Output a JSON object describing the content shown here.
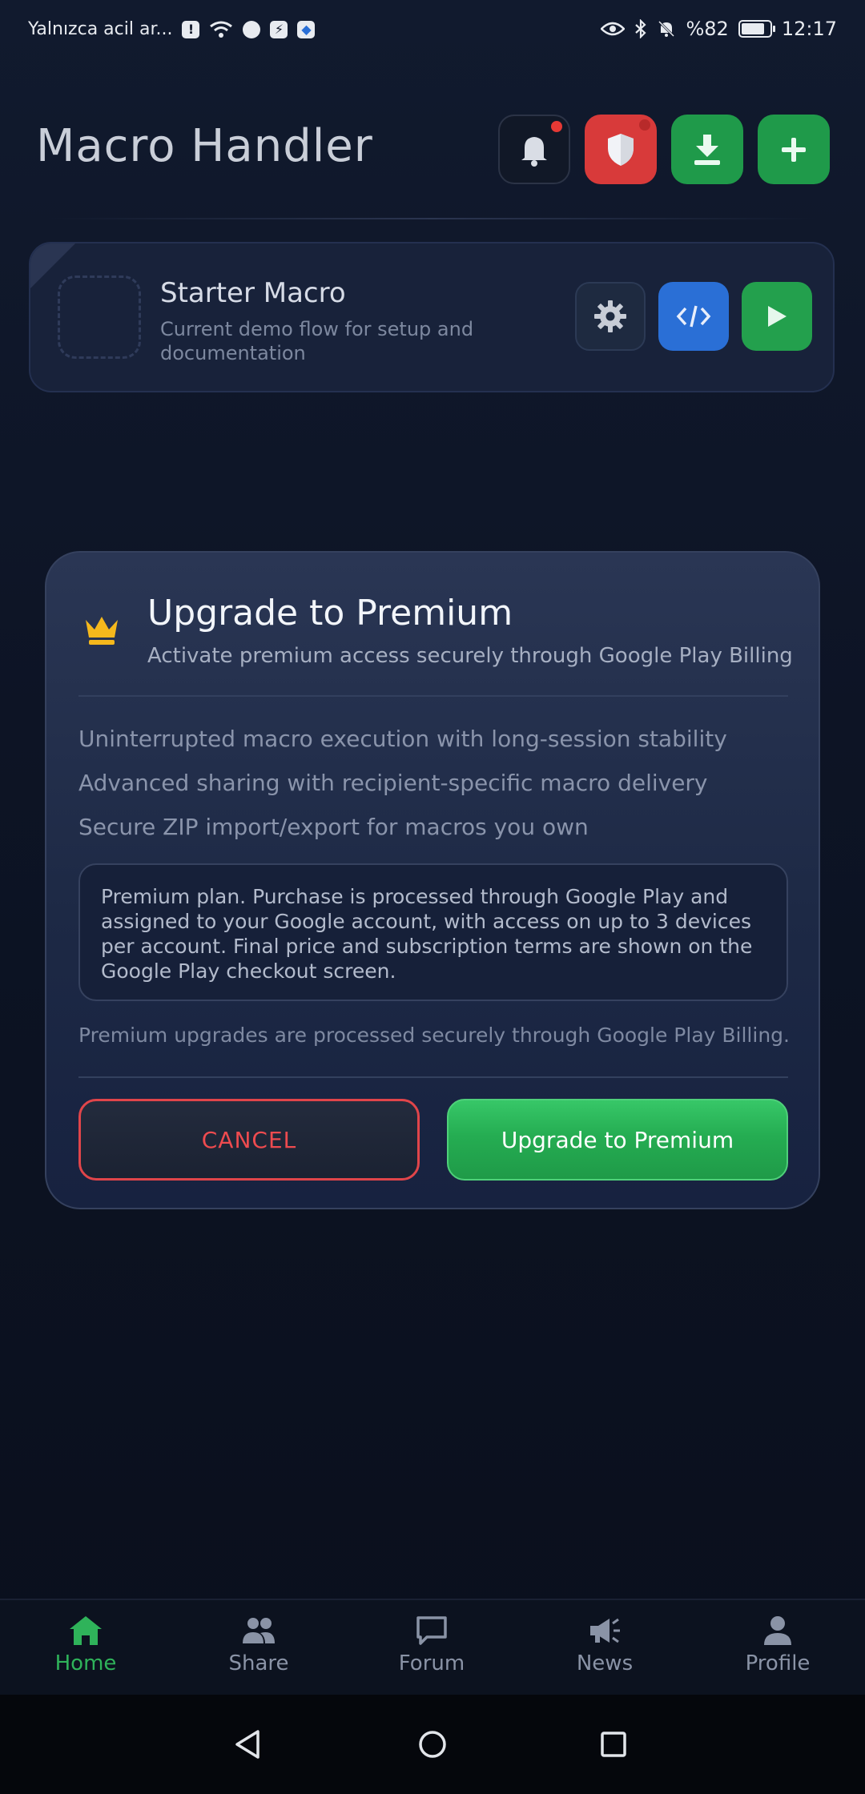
{
  "status_bar": {
    "left_text": "Yalnızca acil ar...",
    "battery_text": "%82",
    "battery_level": 0.82,
    "time": "12:17"
  },
  "header": {
    "title": "Macro Handler",
    "buttons": [
      {
        "name": "notifications",
        "icon": "bell-icon",
        "color": "#111827",
        "badge": true
      },
      {
        "name": "security",
        "icon": "shield-icon",
        "color": "#d83a3a",
        "badge": true
      },
      {
        "name": "download",
        "icon": "download-icon",
        "color": "#1f9a4a"
      },
      {
        "name": "add",
        "icon": "plus-icon",
        "color": "#1f9a4a"
      }
    ]
  },
  "macro_card": {
    "name": "Starter Macro",
    "description": "Current demo flow for setup and documentation"
  },
  "modal": {
    "title": "Upgrade to Premium",
    "subtitle": "Activate premium access securely through Google Play Billing",
    "features": [
      "Uninterrupted macro execution with long-session stability",
      "Advanced sharing with recipient-specific macro delivery",
      "Secure ZIP import/export for macros you own"
    ],
    "info": "Premium plan. Purchase is processed through Google Play and assigned to your Google account, with access on up to 3 devices per account. Final price and subscription terms are shown on the Google Play checkout screen.",
    "footnote": "Premium upgrades are processed securely through Google Play Billing.",
    "cancel_label": "CANCEL",
    "upgrade_label": "Upgrade to Premium",
    "accent_colors": {
      "cancel": "#ee4b4f",
      "upgrade": "#25ad52",
      "crown": "#f5b81c"
    }
  },
  "bottom_nav": {
    "items": [
      {
        "label": "Home",
        "icon": "home-icon",
        "active": true
      },
      {
        "label": "Share",
        "icon": "people-icon",
        "active": false
      },
      {
        "label": "Forum",
        "icon": "chat-icon",
        "active": false
      },
      {
        "label": "News",
        "icon": "megaphone-icon",
        "active": false
      },
      {
        "label": "Profile",
        "icon": "person-icon",
        "active": false
      }
    ],
    "active_color": "#2fb35a"
  }
}
